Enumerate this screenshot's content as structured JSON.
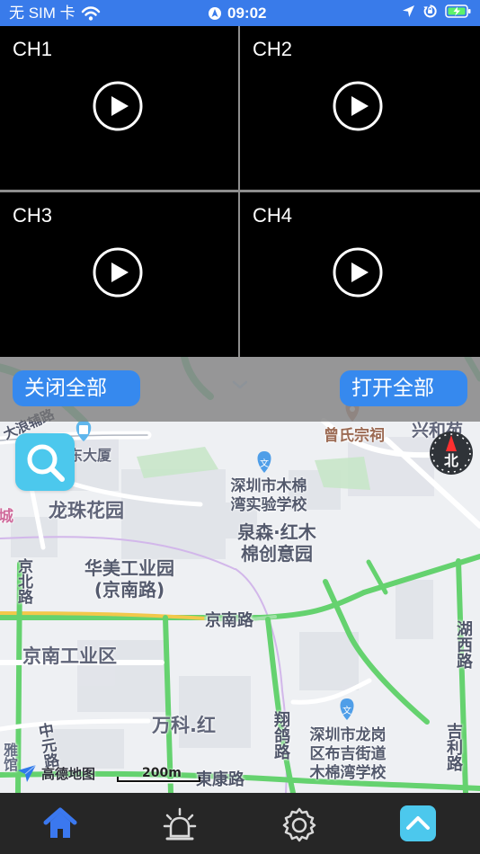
{
  "status_bar": {
    "carrier": "无 SIM 卡",
    "time": "09:02",
    "background": "#397bea",
    "icons": [
      "wifi-icon",
      "alarm-location-icon",
      "location-arrow-icon",
      "orientation-lock-icon",
      "battery-charging-icon"
    ]
  },
  "channels": [
    {
      "label": "CH1",
      "icon": "play-circle-icon"
    },
    {
      "label": "CH2",
      "icon": "play-circle-icon"
    },
    {
      "label": "CH3",
      "icon": "play-circle-icon"
    },
    {
      "label": "CH4",
      "icon": "play-circle-icon"
    }
  ],
  "controls": {
    "close_all": "关闭全部",
    "open_all": "打开全部",
    "accent": "#3689ee",
    "collapse_icon": "chevron-down-icon"
  },
  "map": {
    "labels": {
      "top_left_road": "大浪辅路",
      "building_top_left": "东大厦",
      "poi_top_right": "曾氏宗祠",
      "poi_far_right": "兴和苑",
      "school_1": "深圳市木棉湾实验学校",
      "longzhu": "龙珠花园",
      "quansen": "泉森·红木棉创意园",
      "huamei": "华美工业园(京南路)",
      "jingbei_road": "京北路",
      "jingnan_road": "京南路",
      "jingnan_industrial": "京南工业区",
      "huxi_road": "湖西路",
      "xianggu_road": "翔鸽路",
      "wanke": "万科.红",
      "school_2": "深圳市龙岗区布吉街道木棉湾学校",
      "jili_road": "吉利路",
      "zhongyuan_road": "中元路",
      "dongkang_road": "東康路",
      "left_partial": "雅馆",
      "left_edge": "城"
    },
    "search_icon": "search-icon",
    "compass_label": "北",
    "logo_text": "高德地图",
    "scale_label": "200m"
  },
  "tab_bar": {
    "items": [
      {
        "name": "home",
        "icon": "home-icon",
        "active": true
      },
      {
        "name": "alarm",
        "icon": "alarm-siren-icon",
        "active": false
      },
      {
        "name": "settings",
        "icon": "gear-icon",
        "active": false
      },
      {
        "name": "collapse",
        "icon": "chevron-up-icon",
        "active": false
      }
    ],
    "active_color": "#3b78ef"
  }
}
